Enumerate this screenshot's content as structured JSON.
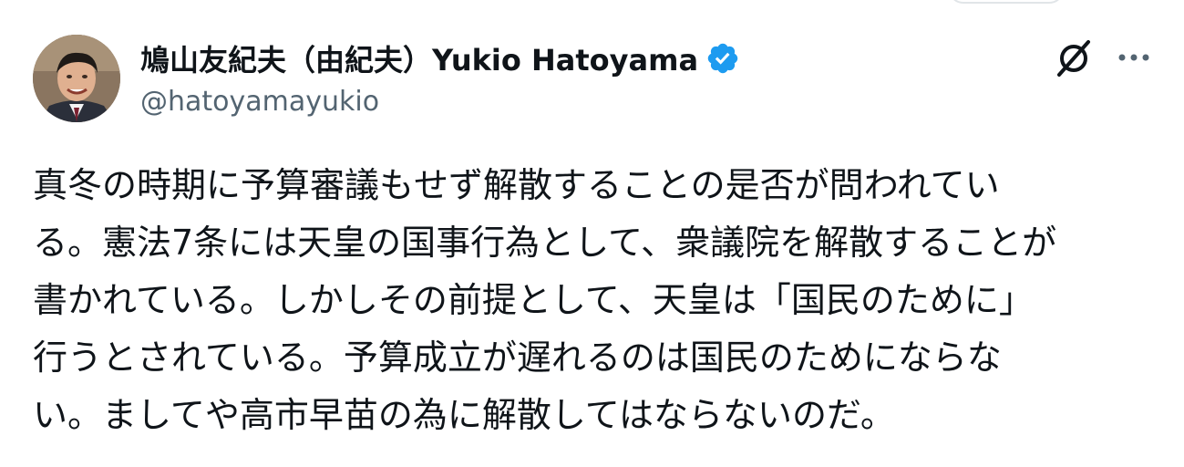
{
  "author": {
    "display_name": "鳩山友紀夫（由紀夫）Yukio Hatoyama",
    "handle": "@hatoyamayukio",
    "verified": true,
    "verified_color": "#1d9bf0"
  },
  "tweet": {
    "lines": [
      "真冬の時期に予算審議もせず解散することの是否が問われてい",
      "る。憲法7条には天皇の国事行為として、衆議院を解散することが",
      "書かれている。しかしその前提として、天皇は「国民のために」",
      "行うとされている。予算成立が遅れるのは国民のためにならな",
      "い。ましてや高市早苗の為に解散してはならないのだ。"
    ]
  },
  "icons": {
    "verified": "verified-badge-icon",
    "grok": "grok-icon",
    "more": "more-options-icon"
  },
  "colors": {
    "text_primary": "#0f1419",
    "text_secondary": "#536471",
    "accent": "#1d9bf0"
  }
}
